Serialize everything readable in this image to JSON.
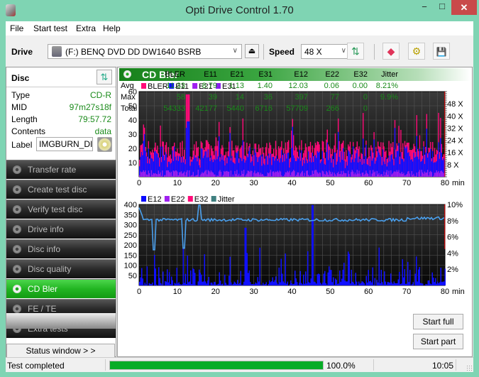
{
  "window": {
    "title": "Opti Drive Control 1.70",
    "minimize": "−",
    "maximize": "□",
    "close": "✕"
  },
  "menu": [
    "File",
    "Start test",
    "Extra",
    "Help"
  ],
  "toolbar": {
    "drive_label": "Drive",
    "drive_value": "(F:)  BENQ DVD DD DW1640 BSRB",
    "speed_label": "Speed",
    "speed_value": "48 X",
    "chevron": "∨",
    "eject": "⏏",
    "refresh": "⇅",
    "erase": "◆",
    "settings": "⚙",
    "save": "💾"
  },
  "disc": {
    "title": "Disc",
    "fields": [
      {
        "key": "Type",
        "value": "CD-R"
      },
      {
        "key": "MID",
        "value": "97m27s18f"
      },
      {
        "key": "Length",
        "value": "79:57.72"
      },
      {
        "key": "Contents",
        "value": "data"
      }
    ],
    "label_key": "Label",
    "label_value": "IMGBURN_DIS"
  },
  "nav": [
    {
      "label": "Transfer rate",
      "active": false
    },
    {
      "label": "Create test disc",
      "active": false
    },
    {
      "label": "Verify test disc",
      "active": false
    },
    {
      "label": "Drive info",
      "active": false
    },
    {
      "label": "Disc info",
      "active": false
    },
    {
      "label": "Disc quality",
      "active": false
    },
    {
      "label": "CD Bler",
      "active": true
    },
    {
      "label": "FE / TE",
      "active": false
    },
    {
      "label": "Extra tests",
      "active": false
    }
  ],
  "status_window_button": "Status window > >",
  "main": {
    "title": "CD Bler"
  },
  "stats": {
    "columns": [
      "BLER",
      "E11",
      "E21",
      "E31",
      "E12",
      "E22",
      "E32",
      "Jitter"
    ],
    "rows": [
      {
        "label": "Avg",
        "values": [
          "11.33",
          "8.79",
          "1.13",
          "1.40",
          "12.03",
          "0.06",
          "0.00",
          "8.21%"
        ]
      },
      {
        "label": "Max",
        "values": [
          "58",
          "39",
          "14",
          "36",
          "397",
          "77",
          "0",
          "9.9%"
        ]
      },
      {
        "label": "Total",
        "values": [
          "54333",
          "42177",
          "5440",
          "6716",
          "57709",
          "266",
          "0",
          ""
        ]
      }
    ]
  },
  "buttons": {
    "start_full": "Start full",
    "start_part": "Start part"
  },
  "statusbar": {
    "text": "Test completed",
    "progress_percent": 100,
    "progress_label": "100.0%",
    "time": "10:05"
  },
  "chart_data": [
    {
      "type": "bar",
      "title": "BLER / E11 / E21 / E31",
      "legend": [
        {
          "name": "BLER",
          "color": "#ff0a78"
        },
        {
          "name": "E11",
          "color": "#0a0aff"
        },
        {
          "name": "E21",
          "color": "#a020f0"
        },
        {
          "name": "E31",
          "color": "#8a1ef0"
        }
      ],
      "legend_position": "top-left",
      "xlabel": "min",
      "xlim": [
        0,
        80
      ],
      "xticks": [
        0,
        10,
        20,
        30,
        40,
        50,
        60,
        70,
        80
      ],
      "ylim": [
        0,
        60
      ],
      "yticks": [
        10,
        20,
        30,
        40,
        50,
        60
      ],
      "y2ticks": [
        "8 X",
        "16 X",
        "24 X",
        "32 X",
        "40 X",
        "48 X"
      ],
      "y2lim": [
        0,
        56
      ],
      "grid": true,
      "series_summary": {
        "BLER_max": 58,
        "E11_max": 39,
        "E21_max": 14,
        "E31_max": 36,
        "BLER_avg": 11.33,
        "E11_avg": 8.79
      }
    },
    {
      "type": "bar",
      "title": "E12 / E22 / E32 / Jitter",
      "legend": [
        {
          "name": "E12",
          "color": "#0a0aff"
        },
        {
          "name": "E22",
          "color": "#a020f0"
        },
        {
          "name": "E32",
          "color": "#ff0a78"
        },
        {
          "name": "Jitter",
          "color": "#3f7f7f"
        }
      ],
      "legend_position": "top-left",
      "xlabel": "min",
      "xlim": [
        0,
        80
      ],
      "xticks": [
        0,
        10,
        20,
        30,
        40,
        50,
        60,
        70,
        80
      ],
      "ylim": [
        0,
        400
      ],
      "yticks": [
        50,
        100,
        150,
        200,
        250,
        300,
        350,
        400
      ],
      "y2ticks": [
        "2%",
        "4%",
        "6%",
        "8%",
        "10%"
      ],
      "y2lim": [
        0,
        10
      ],
      "grid": true,
      "jitter_line_color": "#4aa0ee",
      "series_summary": {
        "E12_max": 397,
        "E22_max": 77,
        "Jitter_avg_percent": 8.21,
        "Jitter_max_percent": 9.9
      }
    }
  ]
}
